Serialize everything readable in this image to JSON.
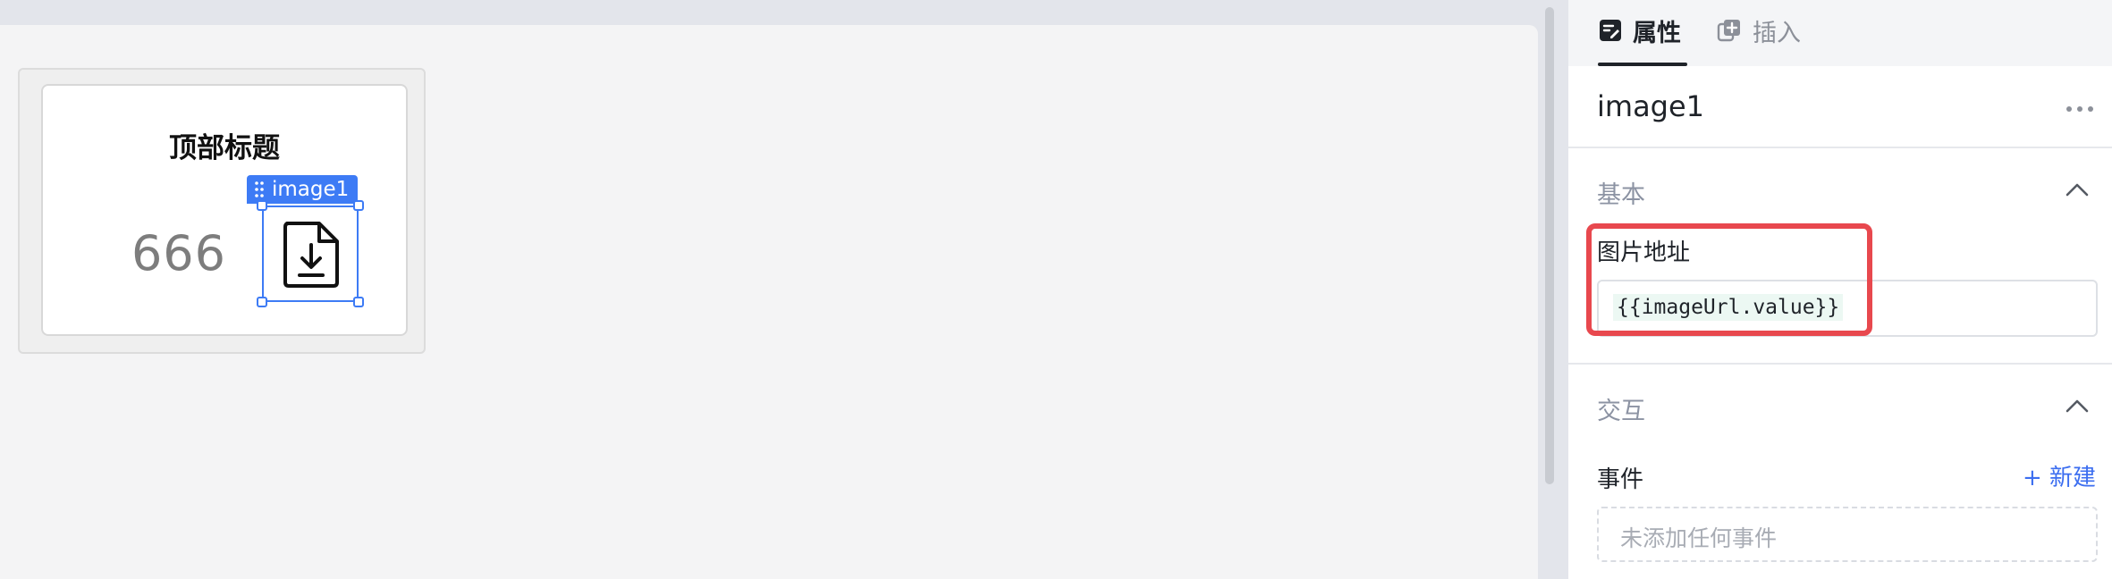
{
  "canvas": {
    "card": {
      "title": "顶部标题",
      "number": "666"
    },
    "selection": {
      "chip_label": "image1",
      "image_icon": "file-download-icon"
    }
  },
  "panel": {
    "tabs": [
      {
        "label": "属性",
        "icon": "edit-props-icon",
        "active": true
      },
      {
        "label": "插入",
        "icon": "add-layer-icon",
        "active": false
      }
    ],
    "component_name": "image1",
    "sections": {
      "basic": {
        "title": "基本",
        "image_url_label": "图片地址",
        "image_url_value": "{{imageUrl.value}}"
      },
      "interaction": {
        "title": "交互",
        "events_label": "事件",
        "new_button": "+ 新建",
        "empty_text": "未添加任何事件"
      }
    }
  },
  "colors": {
    "accent": "#3d7bf5",
    "highlight": "#e8484e",
    "link": "#3c6ef0"
  }
}
